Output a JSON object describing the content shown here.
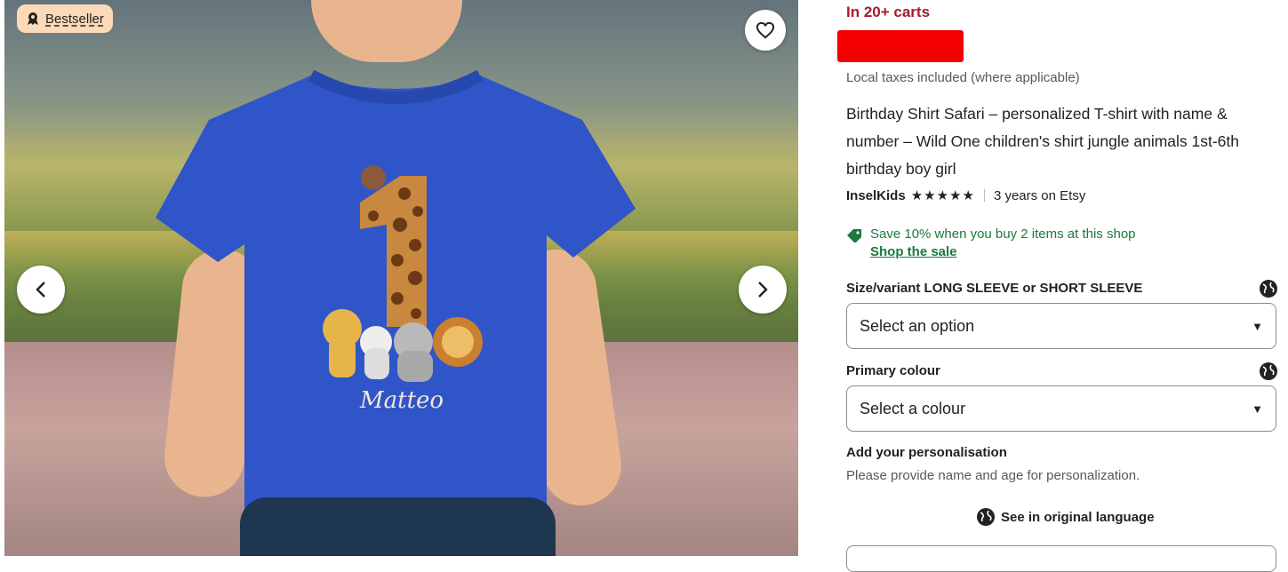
{
  "gallery": {
    "badge_label": "Bestseller",
    "shirt_name_text": "Matteo",
    "shirt_number_text": "1",
    "icons": {
      "badge": "award-ribbon-icon",
      "favorite": "heart-outline-icon",
      "prev": "chevron-left-icon",
      "next": "chevron-right-icon"
    }
  },
  "listing": {
    "carts_text": "In 20+ carts",
    "tax_note": "Local taxes included (where applicable)",
    "title": "Birthday Shirt Safari – personalized T-shirt with name & number – Wild One children's shirt jungle animals 1st-6th birthday boy girl",
    "shop_name": "InselKids",
    "stars": "★★★★★",
    "rating_value": 5,
    "shop_age": "3 years on Etsy",
    "sale_text": "Save 10% when you buy 2 items at this shop",
    "sale_link": "Shop the sale",
    "colors": {
      "carts": "#a61a2e",
      "sale": "#1b7a3e",
      "badge_bg": "#fcd9b8"
    }
  },
  "options": {
    "size_label": "Size/variant LONG SLEEVE or SHORT SLEEVE",
    "size_value": "Select an option",
    "colour_label": "Primary colour",
    "colour_value": "Select a colour"
  },
  "personalisation": {
    "label": "Add your personalisation",
    "help": "Please provide name and age for personalization."
  },
  "see_original": "See in original language"
}
